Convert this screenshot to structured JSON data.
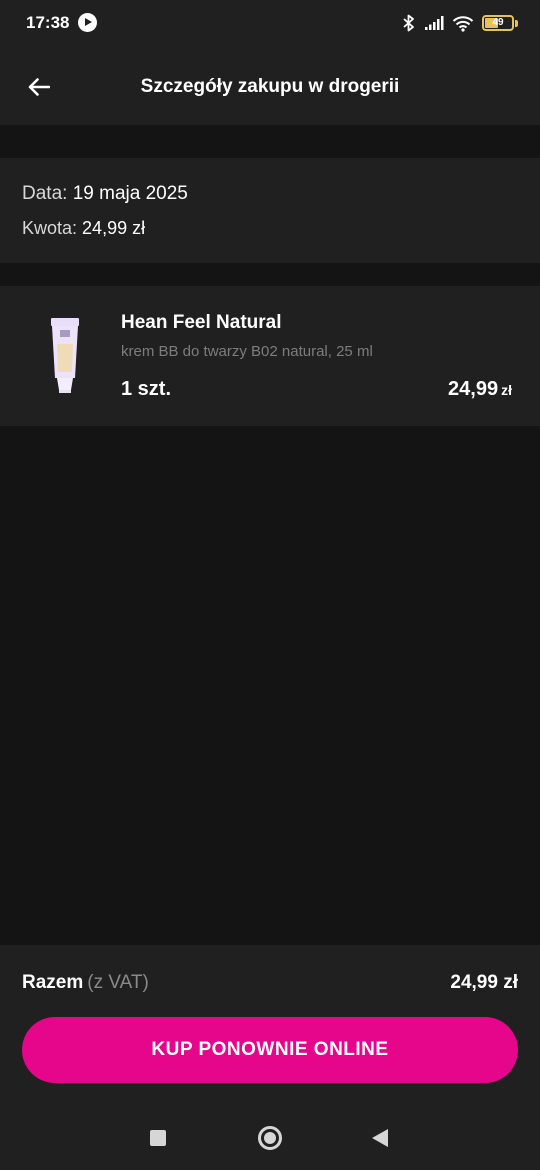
{
  "status_bar": {
    "time": "17:38",
    "battery": "49",
    "icons": [
      "play-icon",
      "bluetooth-icon",
      "signal-icon",
      "wifi-icon",
      "battery-icon"
    ]
  },
  "header": {
    "title": "Szczegóły zakupu w drogerii"
  },
  "info": {
    "date_label": "Data:",
    "date_value": "19 maja 2025",
    "amount_label": "Kwota:",
    "amount_value": "24,99 zł"
  },
  "product": {
    "name": "Hean Feel Natural",
    "description": "krem BB do twarzy B02 natural, 25 ml",
    "quantity": "1 szt.",
    "price": "24,99",
    "currency": "zł"
  },
  "footer": {
    "total_label": "Razem",
    "total_vat": "(z VAT)",
    "total_value": "24,99 zł",
    "buy_again_label": "KUP PONOWNIE ONLINE"
  },
  "colors": {
    "accent": "#e5068c",
    "background": "#141414",
    "card": "#202020"
  }
}
